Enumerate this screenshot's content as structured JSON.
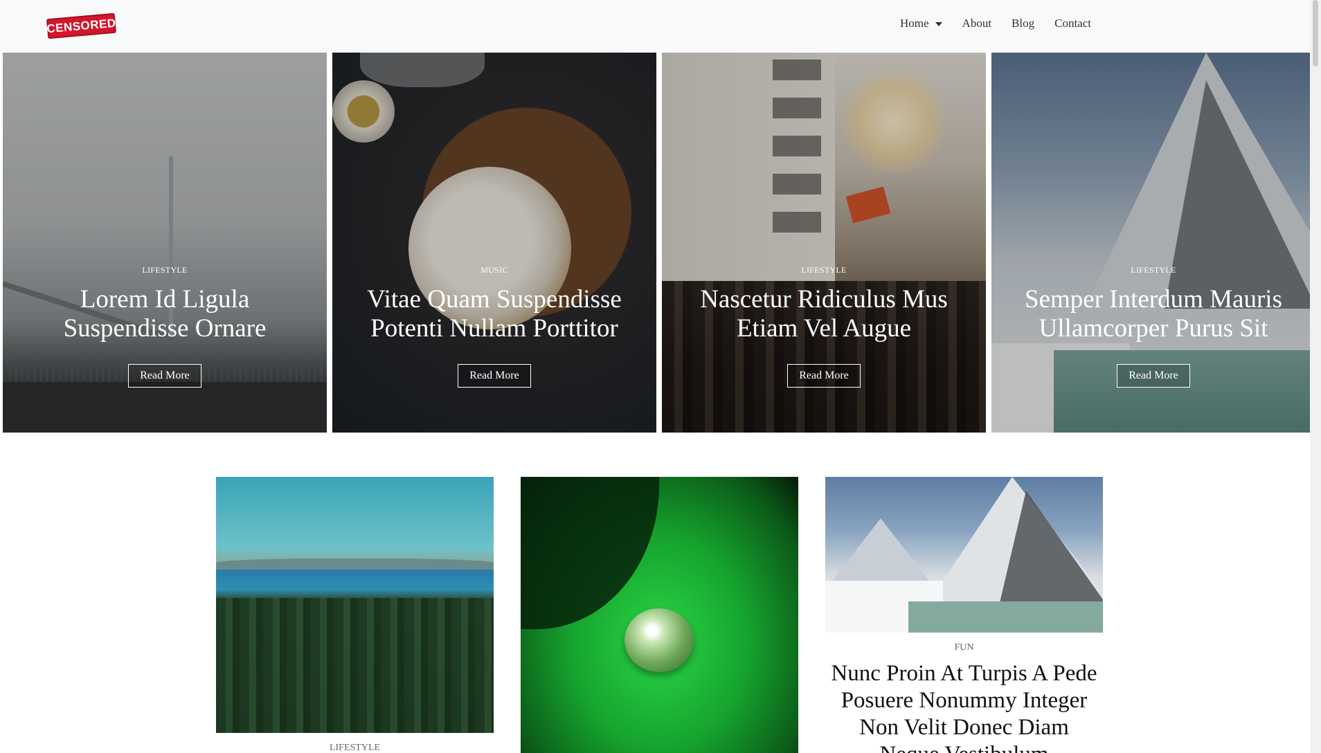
{
  "header": {
    "logo_text": "CENSORED",
    "nav": [
      {
        "label": "Home",
        "has_dropdown": true
      },
      {
        "label": "About",
        "has_dropdown": false
      },
      {
        "label": "Blog",
        "has_dropdown": false
      },
      {
        "label": "Contact",
        "has_dropdown": false
      }
    ]
  },
  "hero": [
    {
      "category": "LIFESTYLE",
      "title": "Lorem Id Ligula Suspendisse Ornare",
      "button": "Read More"
    },
    {
      "category": "MUSIC",
      "title": "Vitae Quam Suspendisse Potenti Nullam Porttitor",
      "button": "Read More"
    },
    {
      "category": "LIFESTYLE",
      "title": "Nascetur Ridiculus Mus Etiam Vel Augue",
      "button": "Read More"
    },
    {
      "category": "LIFESTYLE",
      "title": "Semper Interdum Mauris Ullamcorper Purus Sit",
      "button": "Read More"
    }
  ],
  "articles": [
    {
      "category": "LIFESTYLE",
      "title": ""
    },
    {
      "category": "",
      "title": ""
    },
    {
      "category": "FUN",
      "title": "Nunc Proin At Turpis A Pede Posuere Nonummy Integer Non Velit Donec Diam Neque Vestibulum"
    }
  ],
  "colors": {
    "header_bg": "#f8f9fa",
    "logo_red": "#d3152b",
    "nav_text": "#333333"
  }
}
